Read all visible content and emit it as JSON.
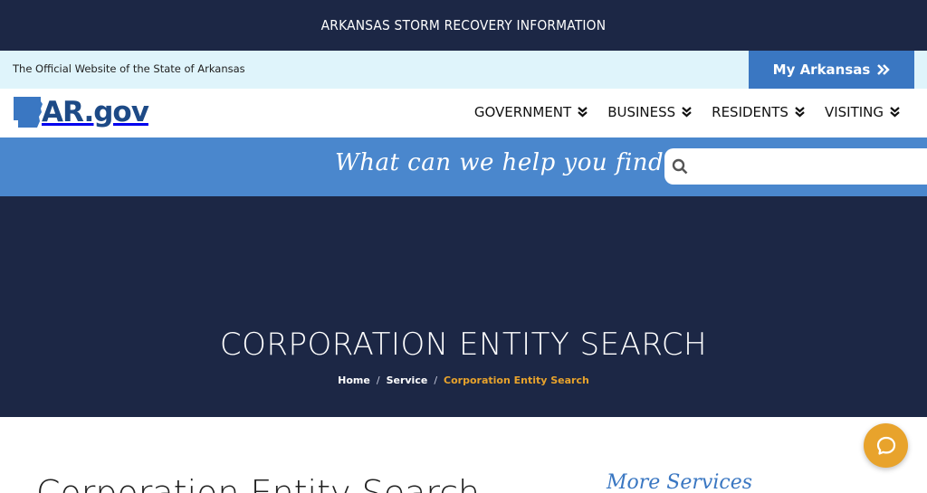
{
  "alert_bar": {
    "text": "ARKANSAS STORM RECOVERY INFORMATION"
  },
  "official_bar": {
    "text": "The Official Website of the State of Arkansas",
    "my_arkansas_label": "My Arkansas"
  },
  "header": {
    "logo_text": "AR.gov",
    "nav": [
      {
        "label": "GOVERNMENT"
      },
      {
        "label": "BUSINESS"
      },
      {
        "label": "RESIDENTS"
      },
      {
        "label": "VISITING"
      }
    ]
  },
  "search": {
    "prompt": "What can we help you find?",
    "placeholder": "",
    "value": ""
  },
  "hero": {
    "title": "CORPORATION ENTITY SEARCH",
    "breadcrumb": [
      "Home",
      "Service",
      "Corporation Entity Search"
    ]
  },
  "content": {
    "heading": "Corporation Entity Search",
    "more_services": "More Services"
  },
  "icons": {
    "logo": "arkansas-state-shape-icon",
    "my_arkansas": "double-chevron-right-icon",
    "nav": "double-chevron-down-icon",
    "search": "search-icon",
    "chat": "chat-bubble-icon"
  },
  "colors": {
    "navy": "#1c2745",
    "blue": "#4a87cd",
    "button_blue": "#3a77c2",
    "light_blue": "#dff4fb",
    "orange": "#e8a32c"
  }
}
